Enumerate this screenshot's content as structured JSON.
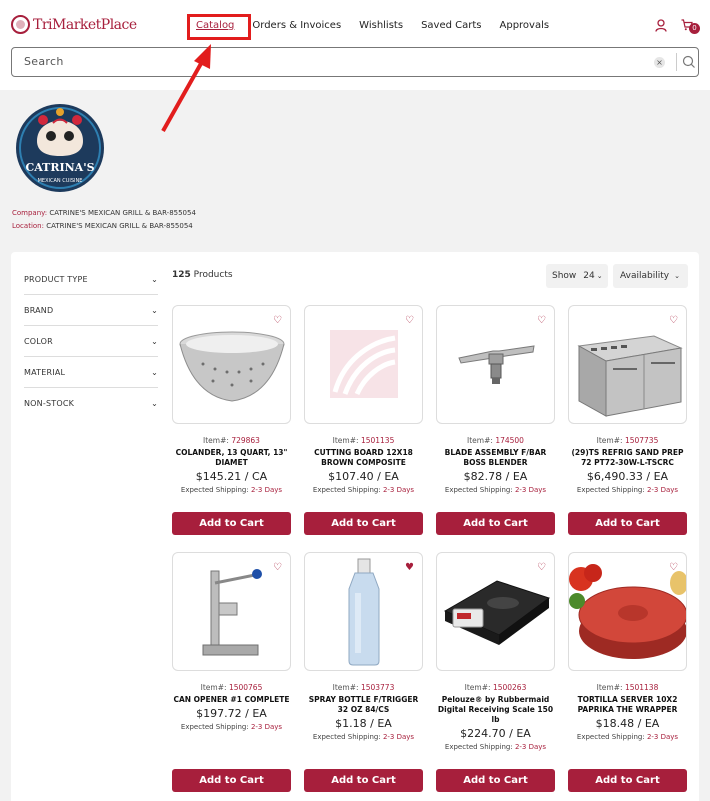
{
  "header": {
    "logo_text": "TriMarketPlace",
    "nav": [
      "Catalog",
      "Orders & Invoices",
      "Wishlists",
      "Saved Carts",
      "Approvals"
    ],
    "cart_count": "0",
    "search_placeholder": "Search"
  },
  "company": {
    "logo_text": "CATRINA'S",
    "logo_subtext": "MEXICAN CUISINE",
    "company_label": "Company:",
    "company_value": "CATRINE'S MEXICAN GRILL & BAR-855054",
    "location_label": "Location:",
    "location_value": "CATRINE'S MEXICAN GRILL & BAR-855054"
  },
  "filters": [
    "PRODUCT TYPE",
    "BRAND",
    "COLOR",
    "MATERIAL",
    "NON-STOCK"
  ],
  "toolbar": {
    "count": "125",
    "count_label": "Products",
    "show_label": "Show",
    "show_value": "24",
    "sort_label": "Availability"
  },
  "products": [
    {
      "item_label": "Item#:",
      "item": "729863",
      "name": "COLANDER, 13 QUART, 13\" DIAMET",
      "price": "$145.21 / CA",
      "ship_label": "Expected Shipping:",
      "ship_days": "2-3 Days",
      "button": "Add to Cart"
    },
    {
      "item_label": "Item#:",
      "item": "1501135",
      "name": "CUTTING BOARD 12X18 BROWN COMPOSITE",
      "price": "$107.40 / EA",
      "ship_label": "Expected Shipping:",
      "ship_days": "2-3 Days",
      "button": "Add to Cart"
    },
    {
      "item_label": "Item#:",
      "item": "174500",
      "name": "BLADE ASSEMBLY F/BAR BOSS BLENDER",
      "price": "$82.78 / EA",
      "ship_label": "Expected Shipping:",
      "ship_days": "2-3 Days",
      "button": "Add to Cart"
    },
    {
      "item_label": "Item#:",
      "item": "1507735",
      "name": "(29)TS REFRIG SAND PREP 72 PT72-30W-L-TSCRC",
      "price": "$6,490.33 / EA",
      "ship_label": "Expected Shipping:",
      "ship_days": "2-3 Days",
      "button": "Add to Cart"
    },
    {
      "item_label": "Item#:",
      "item": "1500765",
      "name": "CAN OPENER #1 COMPLETE",
      "price": "$197.72 / EA",
      "ship_label": "Expected Shipping:",
      "ship_days": "2-3 Days",
      "button": "Add to Cart"
    },
    {
      "item_label": "Item#:",
      "item": "1503773",
      "name": "SPRAY BOTTLE F/TRIGGER 32 OZ 84/CS",
      "price": "$1.18 / EA",
      "ship_label": "Expected Shipping:",
      "ship_days": "2-3 Days",
      "button": "Add to Cart"
    },
    {
      "item_label": "Item#:",
      "item": "1500263",
      "name": "Pelouze® by Rubbermaid Digital Receiving Scale 150 lb",
      "price": "$224.70 / EA",
      "ship_label": "Expected Shipping:",
      "ship_days": "2-3 Days",
      "button": "Add to Cart"
    },
    {
      "item_label": "Item#:",
      "item": "1501138",
      "name": "TORTILLA SERVER 10X2 PAPRIKA THE WRAPPER",
      "price": "$18.48 / EA",
      "ship_label": "Expected Shipping:",
      "ship_days": "2-3 Days",
      "button": "Add to Cart"
    }
  ],
  "colors": {
    "brand": "#a71f3c",
    "highlight": "#e21d1d"
  }
}
